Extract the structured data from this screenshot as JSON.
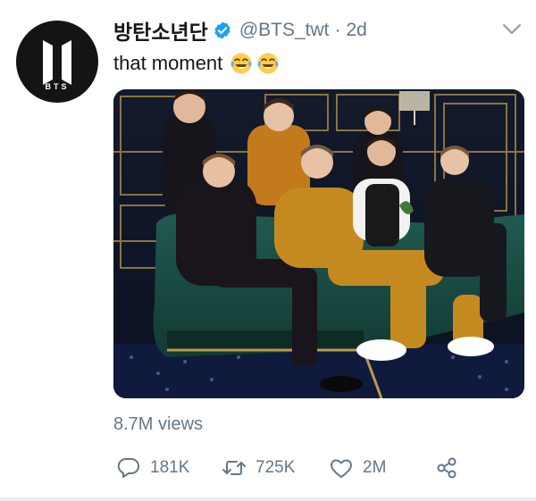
{
  "tweet": {
    "display_name": "방탄소년단",
    "handle": "@BTS_twt",
    "separator": "·",
    "time": "2d",
    "text": "that moment",
    "emojis": [
      "face-with-tears-of-joy",
      "face-with-tears-of-joy"
    ],
    "views": "8.7M views",
    "avatar_logo_text": "BTS"
  },
  "actions": {
    "reply_count": "181K",
    "retweet_count": "725K",
    "like_count": "2M"
  },
  "icons": {
    "verified": "verified-badge-icon",
    "caret": "chevron-down-icon",
    "reply": "reply-icon",
    "retweet": "retweet-icon",
    "like": "heart-icon",
    "share": "share-icon"
  },
  "colors": {
    "verified": "#1da1f2",
    "secondary_text": "#657786",
    "primary_text": "#14171a"
  }
}
